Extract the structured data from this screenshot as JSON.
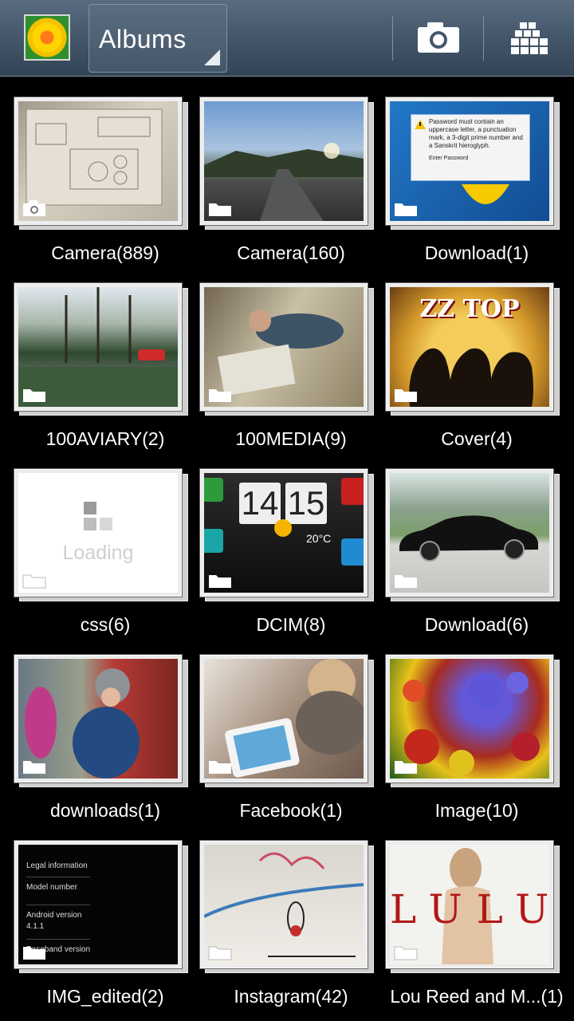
{
  "header": {
    "title": "Albums"
  },
  "albums": [
    {
      "label": "Camera(889)",
      "badge": "camera-icon"
    },
    {
      "label": "Camera(160)",
      "badge": "folder-icon"
    },
    {
      "label": "Download(1)",
      "badge": "folder-icon"
    },
    {
      "label": "100AVIARY(2)",
      "badge": "folder-icon"
    },
    {
      "label": "100MEDIA(9)",
      "badge": "folder-icon"
    },
    {
      "label": "Cover(4)",
      "badge": "folder-icon"
    },
    {
      "label": "css(6)",
      "badge": "folder-icon"
    },
    {
      "label": "DCIM(8)",
      "badge": "folder-icon"
    },
    {
      "label": "Download(6)",
      "badge": "folder-icon"
    },
    {
      "label": "downloads(1)",
      "badge": "folder-icon"
    },
    {
      "label": "Facebook(1)",
      "badge": "folder-icon"
    },
    {
      "label": "Image(10)",
      "badge": "folder-icon"
    },
    {
      "label": "IMG_edited(2)",
      "badge": "folder-icon"
    },
    {
      "label": "Instagram(42)",
      "badge": "folder-icon"
    },
    {
      "label": "Lou Reed and M...(1)",
      "badge": "folder-icon"
    }
  ],
  "thumb_text": {
    "dialog_message": "Password must contain an uppercase letter, a punctuation mark, a 3-digit prime number and a Sanskrit hieroglyph.",
    "dialog_field_label": "Enter Password",
    "zz_title": "ZZ TOP",
    "loading": "Loading",
    "clock_hours": "14",
    "clock_minutes": "15",
    "temperature": "20°C",
    "settings_1": "Legal information",
    "settings_2": "Model number",
    "settings_3": "Android version",
    "settings_3_value": "4.1.1",
    "settings_4": "Baseband version",
    "lulu": "LULU"
  },
  "colors": {
    "topbar": "#44566a",
    "background": "#000000",
    "frame": "#ececec"
  }
}
